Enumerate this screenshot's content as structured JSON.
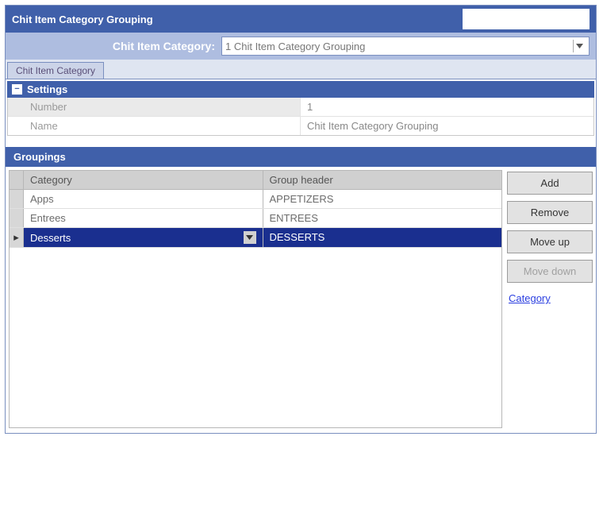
{
  "title": "Chit Item Category Grouping",
  "selector": {
    "label": "Chit Item Category:",
    "selected": "1 Chit Item Category Grouping"
  },
  "tab": "Chit Item Category",
  "settings": {
    "header": "Settings",
    "number_label": "Number",
    "number_value": "1",
    "name_label": "Name",
    "name_value": "Chit Item Category Grouping"
  },
  "groupings": {
    "header": "Groupings",
    "col_category": "Category",
    "col_group_header": "Group header",
    "rows": [
      {
        "category": "Apps",
        "header": "APPETIZERS"
      },
      {
        "category": "Entrees",
        "header": "ENTREES"
      },
      {
        "category": "Desserts",
        "header": "DESSERTS"
      }
    ]
  },
  "buttons": {
    "add": "Add",
    "remove": "Remove",
    "move_up": "Move up",
    "move_down": "Move down",
    "category_link": "Category"
  }
}
